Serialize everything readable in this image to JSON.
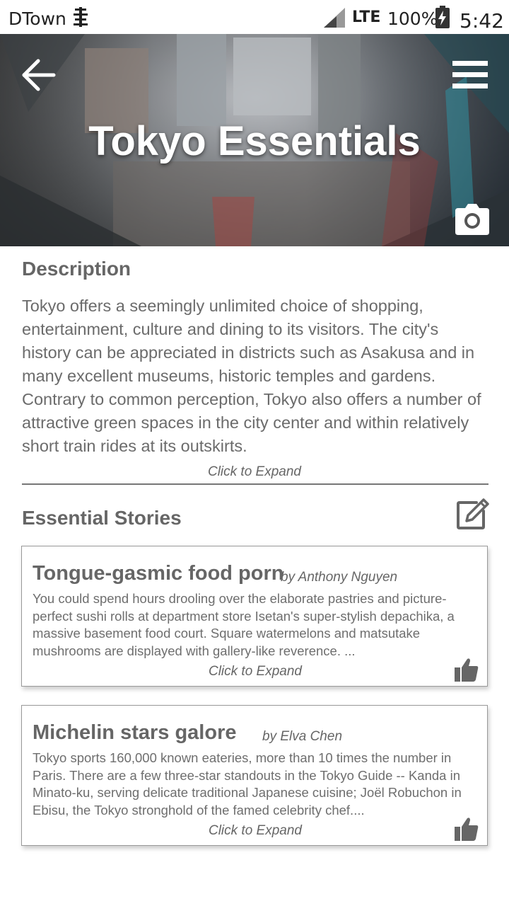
{
  "status_bar": {
    "carrier": "DTown",
    "network": "LTE",
    "battery": "100%",
    "time": "5:42"
  },
  "header": {
    "title": "Tokyo Essentials",
    "back_icon": "arrow-left-icon",
    "menu_icon": "hamburger-menu-icon",
    "camera_icon": "camera-icon"
  },
  "description": {
    "heading": "Description",
    "body": "Tokyo offers a seemingly unlimited choice of shopping, entertainment, culture and dining to its visitors. The city's history can be appreciated in districts such as Asakusa and in many excellent museums, historic temples and gardens. Contrary to common perception, Tokyo also offers a number of attractive green spaces in the city center and within relatively short train rides at its outskirts.",
    "expand_label": "Click to Expand"
  },
  "stories": {
    "heading": "Essential Stories",
    "edit_icon": "edit-icon",
    "items": [
      {
        "title": "Tongue-gasmic food porn",
        "author": "by Anthony Nguyen",
        "body": "You could spend hours drooling over the elaborate pastries and picture-perfect sushi rolls at department store Isetan's super-stylish depachika, a massive basement food court. Square watermelons and matsutake mushrooms are displayed with gallery-like reverence. ...",
        "expand_label": "Click to Expand",
        "like_icon": "thumbs-up-icon"
      },
      {
        "title": "Michelin stars galore",
        "author": "by Elva Chen",
        "body": "Tokyo sports 160,000 known eateries, more than 10 times the number in Paris. There are a few three-star standouts in the Tokyo Guide -- Kanda in Minato-ku, serving delicate traditional Japanese cuisine; Joël Robuchon in Ebisu, the Tokyo stronghold of the famed celebrity chef....",
        "expand_label": "Click to Expand",
        "like_icon": "thumbs-up-icon"
      }
    ]
  },
  "colors": {
    "text_gray": "#666666",
    "body_gray": "#6b6b6b",
    "card_border": "#999999"
  }
}
